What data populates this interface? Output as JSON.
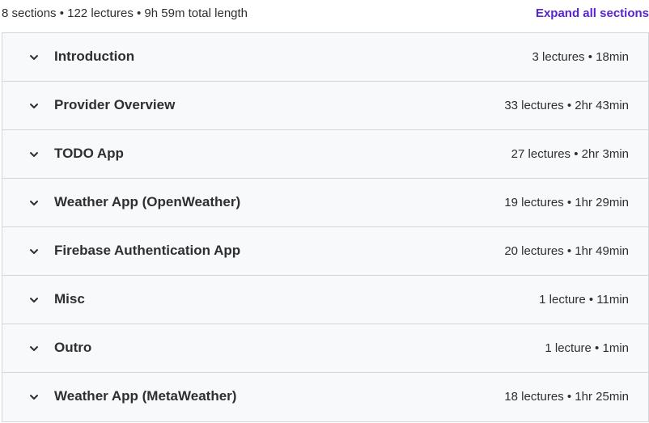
{
  "summary": {
    "text": "8 sections • 122 lectures • 9h 59m total length",
    "expand_label": "Expand all sections"
  },
  "sections": [
    {
      "title": "Introduction",
      "meta": "3 lectures • 18min"
    },
    {
      "title": "Provider Overview",
      "meta": "33 lectures • 2hr 43min"
    },
    {
      "title": "TODO App",
      "meta": "27 lectures • 2hr 3min"
    },
    {
      "title": "Weather App (OpenWeather)",
      "meta": "19 lectures • 1hr 29min"
    },
    {
      "title": "Firebase Authentication App",
      "meta": "20 lectures • 1hr 49min"
    },
    {
      "title": "Misc",
      "meta": "1 lecture • 11min"
    },
    {
      "title": "Outro",
      "meta": "1 lecture • 1min"
    },
    {
      "title": "Weather App (MetaWeather)",
      "meta": "18 lectures • 1hr 25min"
    }
  ],
  "icons": {
    "chevron": "chevron-down-icon"
  },
  "colors": {
    "accent": "#5624d0",
    "row_background": "#f7f9fa",
    "border": "#d1d7dc",
    "text": "#2d2f31"
  }
}
